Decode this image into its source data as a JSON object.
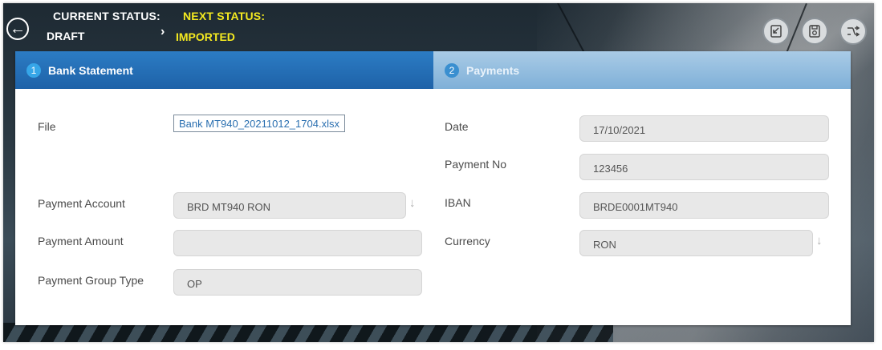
{
  "header": {
    "current_status_label": "CURRENT STATUS:",
    "current_status_value": "DRAFT",
    "next_status_label": "NEXT STATUS:",
    "next_status_value": "IMPORTED",
    "accent_color": "#f5ea20"
  },
  "toolbar": {
    "icons": [
      "export-icon",
      "save-icon",
      "workflow-icon"
    ]
  },
  "tabs": [
    {
      "number": "1",
      "label": "Bank Statement",
      "active": true
    },
    {
      "number": "2",
      "label": "Payments",
      "active": false
    }
  ],
  "form": {
    "file_label": "File",
    "file_value": "Bank MT940_20211012_1704.xlsx",
    "payment_account_label": "Payment Account",
    "payment_account_value": "BRD MT940 RON",
    "payment_amount_label": "Payment Amount",
    "payment_amount_value": "",
    "payment_group_type_label": "Payment Group Type",
    "payment_group_type_value": "OP",
    "date_label": "Date",
    "date_value": "17/10/2021",
    "payment_no_label": "Payment No",
    "payment_no_value": "123456",
    "iban_label": "IBAN",
    "iban_value": "BRDE0001MT940",
    "currency_label": "Currency",
    "currency_value": "RON"
  },
  "colors": {
    "active_tab": "#1e62a8",
    "inactive_tab": "#7fb0d8"
  }
}
